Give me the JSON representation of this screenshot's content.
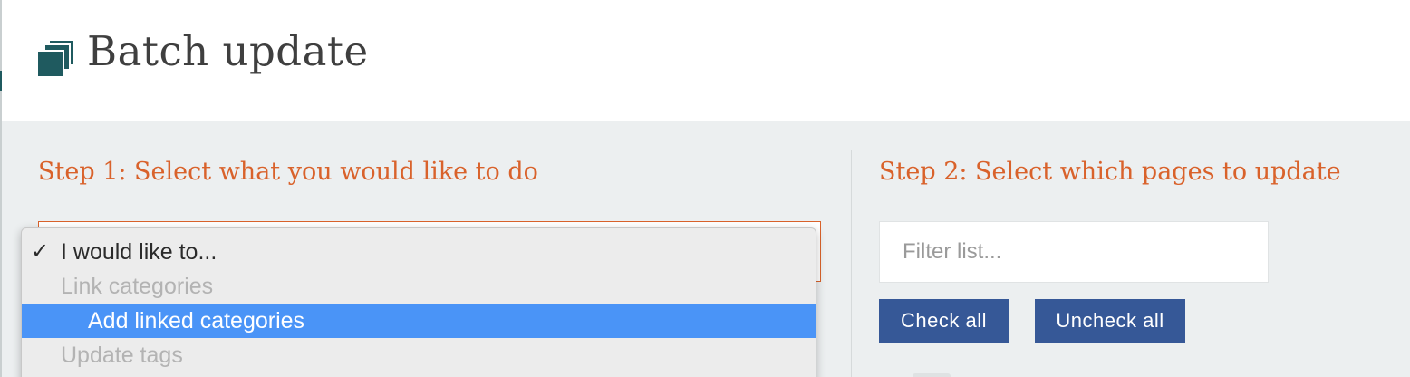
{
  "header": {
    "title": "Batch update",
    "icon": "stacked-pages-icon",
    "icon_color": "#1f5a5f"
  },
  "step1": {
    "heading": "Step 1: Select what you would like to do",
    "dropdown": {
      "options": [
        {
          "label": "I would like to...",
          "selected": true,
          "disabled": false
        },
        {
          "label": "Link categories",
          "selected": false,
          "disabled": true
        },
        {
          "label": "Add linked categories",
          "selected": false,
          "disabled": false,
          "highlighted": true
        },
        {
          "label": "Update tags",
          "selected": false,
          "disabled": true
        }
      ],
      "check_glyph": "✓"
    }
  },
  "step2": {
    "heading": "Step 2: Select which pages to update",
    "filter": {
      "placeholder": "Filter list...",
      "value": ""
    },
    "buttons": {
      "check_all": "Check all",
      "uncheck_all": "Uncheck all"
    }
  },
  "colors": {
    "accent": "#d9622b",
    "button": "#365897",
    "highlight": "#4a94f7",
    "background": "#eceff0"
  }
}
